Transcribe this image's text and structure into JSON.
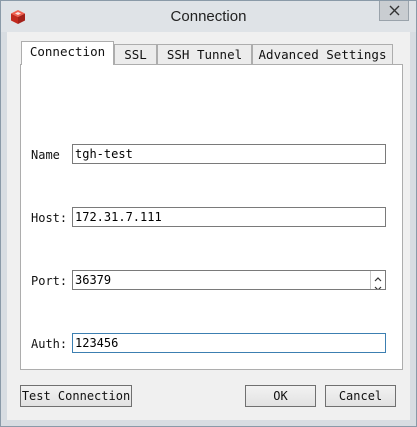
{
  "window": {
    "title": "Connection"
  },
  "tabs": [
    {
      "label": "Connection"
    },
    {
      "label": "SSL"
    },
    {
      "label": "SSH Tunnel"
    },
    {
      "label": "Advanced Settings"
    }
  ],
  "form": {
    "name": {
      "label": "Name",
      "value": "tgh-test"
    },
    "host": {
      "label": "Host:",
      "value": "172.31.7.111"
    },
    "port": {
      "label": "Port:",
      "value": "36379"
    },
    "auth": {
      "label": "Auth:",
      "value": "123456"
    }
  },
  "buttons": {
    "test": "Test Connection",
    "ok": "OK",
    "cancel": "Cancel"
  },
  "icons": {
    "app": "redis-cube-icon",
    "close": "close-icon",
    "spin_up": "chevron-up-icon",
    "spin_down": "chevron-down-icon"
  },
  "colors": {
    "app_icon": "#d9372b",
    "focus_border": "#3c7fb1"
  }
}
